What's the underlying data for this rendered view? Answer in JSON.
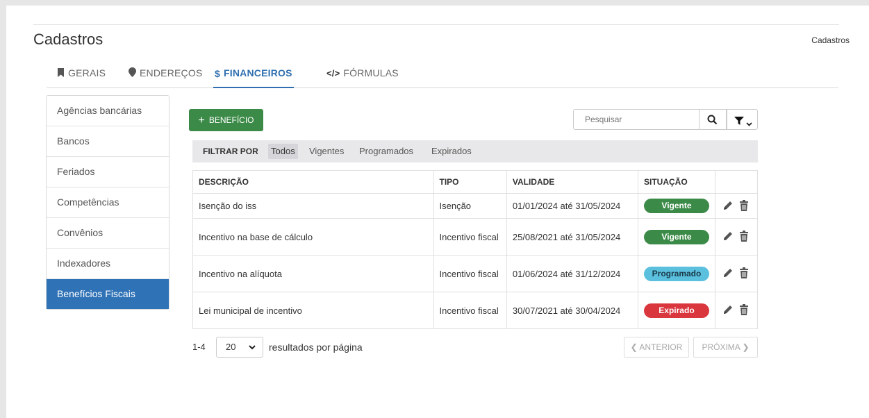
{
  "page": {
    "title": "Cadastros",
    "breadcrumb": "Cadastros"
  },
  "tabs": [
    {
      "label": "GERAIS",
      "icon": "bookmark-icon",
      "active": false
    },
    {
      "label": "ENDEREÇOS",
      "icon": "map-marker-icon",
      "active": false
    },
    {
      "label": "FINANCEIROS",
      "icon": "dollar-icon",
      "active": true
    },
    {
      "label": "FÓRMULAS",
      "icon": "code-icon",
      "active": false
    }
  ],
  "sidebar": {
    "items": [
      {
        "label": "Agências bancárias"
      },
      {
        "label": "Bancos"
      },
      {
        "label": "Feriados"
      },
      {
        "label": "Competências"
      },
      {
        "label": "Convênios"
      },
      {
        "label": "Indexadores"
      },
      {
        "label": "Benefícios Fiscais",
        "active": true
      }
    ]
  },
  "toolbar": {
    "add_label": "BENEFÍCIO",
    "search_placeholder": "Pesquisar"
  },
  "filter": {
    "label": "FILTRAR POR",
    "options": [
      "Todos",
      "Vigentes",
      "Programados",
      "Expirados"
    ],
    "selected": "Todos"
  },
  "table": {
    "headers": [
      "DESCRIÇÃO",
      "TIPO",
      "VALIDADE",
      "SITUAÇÃO"
    ],
    "rows": [
      {
        "descricao": "Isenção do iss",
        "tipo": "Isenção",
        "validade": "01/01/2024 até 31/05/2024",
        "situacao": "Vigente",
        "color": "#3c8a48"
      },
      {
        "descricao": "Incentivo na base de cálculo",
        "tipo": "Incentivo fiscal",
        "validade": "25/08/2021 até 31/05/2024",
        "situacao": "Vigente",
        "color": "#3c8a48"
      },
      {
        "descricao": "Incentivo na alíquota",
        "tipo": "Incentivo fiscal",
        "validade": "01/06/2024 até 31/12/2024",
        "situacao": "Programado",
        "color": "#5bc0de"
      },
      {
        "descricao": "Lei municipal de incentivo",
        "tipo": "Incentivo fiscal",
        "validade": "30/07/2021 até 30/04/2024",
        "situacao": "Expirado",
        "color": "#d9363e"
      }
    ]
  },
  "pagination": {
    "range": "1-4",
    "page_size": "20",
    "per_page_text": "resultados por página",
    "prev_label": "ANTERIOR",
    "next_label": "PRÓXIMA"
  },
  "colors": {
    "primary": "#2f72b6",
    "success": "#3c8a48",
    "info": "#5bc0de",
    "danger": "#d9363e"
  }
}
